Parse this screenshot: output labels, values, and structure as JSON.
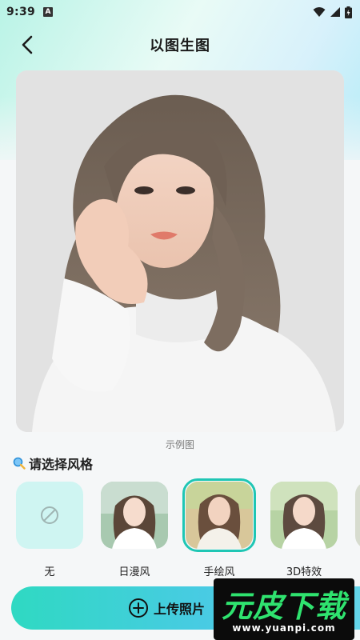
{
  "status_bar": {
    "time": "9:39",
    "a_badge": "A"
  },
  "header": {
    "title": "以图生图"
  },
  "example": {
    "caption": "示例图"
  },
  "styles": {
    "title": "请选择风格",
    "items": [
      {
        "label": "无"
      },
      {
        "label": "日漫风"
      },
      {
        "label": "手绘风"
      },
      {
        "label": "3D特效"
      }
    ],
    "selected_index": 2
  },
  "upload": {
    "label": "上传照片"
  },
  "watermark": {
    "brand": "元皮下载",
    "url": "www.yuanpi.com"
  },
  "colors": {
    "accent": "#1fc6b4",
    "upload_gradient_start": "#2fd9c2",
    "upload_gradient_end": "#64d5ea",
    "watermark_green": "#2fe36f"
  }
}
